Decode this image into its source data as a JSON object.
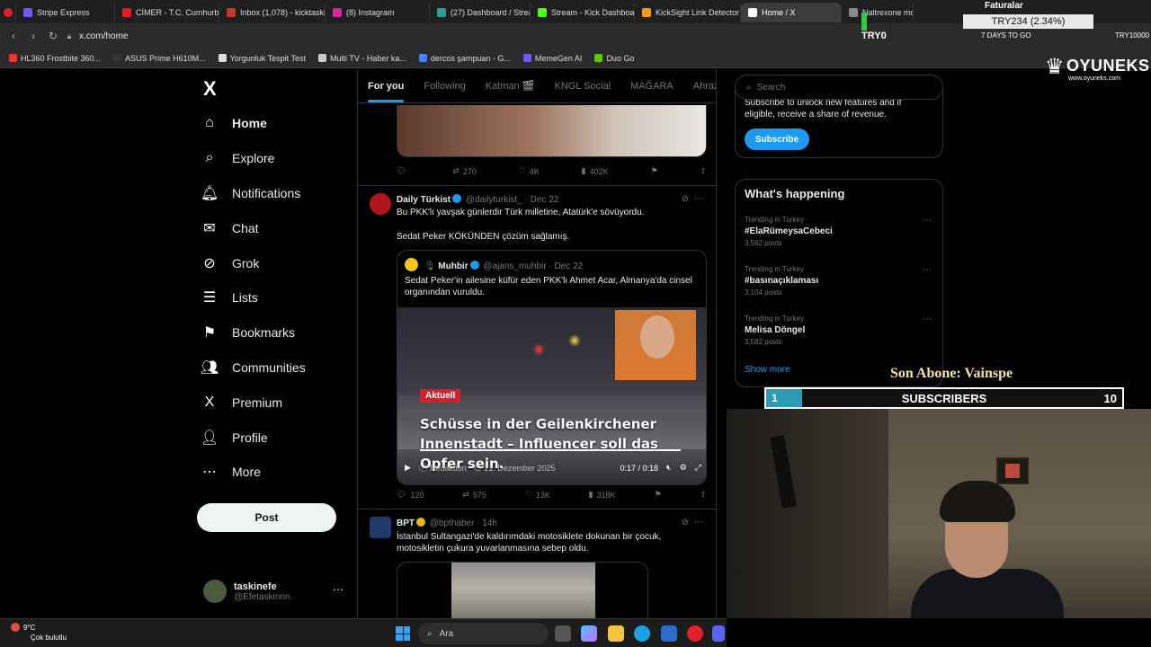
{
  "browser": {
    "tabs": [
      {
        "label": "Stripe Express",
        "color": "#6a5bff"
      },
      {
        "label": "CİMER - T.C. Cumhurbaşk",
        "color": "#e02020"
      },
      {
        "label": "Inbox (1,078) - kicktaskine",
        "color": "#c0392b"
      },
      {
        "label": "(8) Instagram",
        "color": "#d6249f"
      },
      {
        "label": "(27) Dashboard / Streamla",
        "color": "#2aa198"
      },
      {
        "label": "Stream - Kick Dashboard",
        "color": "#53fc18"
      },
      {
        "label": "KickSight Link Detector",
        "color": "#f39c12"
      },
      {
        "label": "Home / X",
        "color": "#ffffff"
      },
      {
        "label": "Naltrexone modulates de",
        "color": "#888888"
      }
    ],
    "url": "x.com/home",
    "bookmarks": [
      "HL360 Frostbite 360...",
      "ASUS Prime H610M...",
      "Yorgunluk Tespit Test",
      "Multi TV - Haber ka...",
      "dercos şampuan - G...",
      "MemeGen AI",
      "Duo Go"
    ]
  },
  "x": {
    "logo": "X",
    "nav": [
      {
        "label": "Home",
        "icon": "home-icon",
        "glyph": "⌂"
      },
      {
        "label": "Explore",
        "icon": "search-icon",
        "glyph": "⌕"
      },
      {
        "label": "Notifications",
        "icon": "bell-icon",
        "glyph": "🔔︎"
      },
      {
        "label": "Chat",
        "icon": "mail-icon",
        "glyph": "✉"
      },
      {
        "label": "Grok",
        "icon": "grok-icon",
        "glyph": "⊘"
      },
      {
        "label": "Lists",
        "icon": "list-icon",
        "glyph": "☰"
      },
      {
        "label": "Bookmarks",
        "icon": "bookmark-icon",
        "glyph": "⚑"
      },
      {
        "label": "Communities",
        "icon": "people-icon",
        "glyph": "👥︎"
      },
      {
        "label": "Premium",
        "icon": "x-premium-icon",
        "glyph": "X"
      },
      {
        "label": "Profile",
        "icon": "person-icon",
        "glyph": "👤︎"
      },
      {
        "label": "More",
        "icon": "more-circle-icon",
        "glyph": "⋯"
      }
    ],
    "post_label": "Post",
    "account": {
      "name": "taskinefe",
      "handle": "@Efetaskinnn"
    },
    "feed_tabs": [
      "For you",
      "Following",
      "Katman 🎬",
      "KNGL Social",
      "MAĞARA",
      "Ahrazlar"
    ],
    "prev_tweet_actions": {
      "replies": "",
      "reposts": "270",
      "likes": "4K",
      "views": "402K"
    },
    "tweet": {
      "name": "Daily Türkist",
      "handle": "@dailyturkist_",
      "date": "· Dec 22",
      "text1": "Bu PKK'lı yavşak günlerdir Türk milletine, Atatürk'e sövüyordu.",
      "text2": "Sedat Peker KÖKÜNDEN çözüm sağlamış.",
      "quote": {
        "name": "Muhbir",
        "handle": "@ajans_muhbir",
        "date": "· Dec 22",
        "text": "Sedat Peker'in ailesine küfür eden PKK'lı Ahmet Acar, Almanya'da cinsel organından vuruldu.",
        "video": {
          "badge": "Aktuell",
          "title": "Schüsse in der Geilenkirchener Innenstadt – Influencer soll das Opfer sein.",
          "source": "Redaktion",
          "date": "21. Dezember 2025",
          "time": "0:17 / 0:18"
        }
      },
      "actions": {
        "replies": "120",
        "reposts": "575",
        "likes": "13K",
        "views": "318K"
      }
    },
    "tweet2": {
      "name": "BPT",
      "handle": "@bpthaber",
      "date": "· 14h",
      "text": "İstanbul Sultangazi'de kaldırımdaki motosiklete dokunan bir çocuk, motosikletin çukura yuvarlanmasına sebep oldu."
    },
    "search_placeholder": "Search",
    "premium": {
      "text": "Subscribe to unlock new features and if eligible, receive a share of revenue.",
      "button": "Subscribe"
    },
    "happening": {
      "title": "What's happening",
      "trends": [
        {
          "context": "Trending in Turkey",
          "name": "#ElaRümeysaCebeci",
          "posts": "3,562 posts"
        },
        {
          "context": "Trending in Turkey",
          "name": "#basınaçıklaması",
          "posts": "3,104 posts"
        },
        {
          "context": "Trending in Turkey",
          "name": "Melisa Döngel",
          "posts": "3,582 posts"
        }
      ],
      "show_more": "Show more"
    }
  },
  "overlay": {
    "stock_title": "Faturalar",
    "stock_change": "TRY234 (2.34%)",
    "stock_code": "TRY0",
    "days_to_go": "7 DAYS TO GO",
    "stock_value": "TRY10000",
    "oyuneks": "OYUNEKS",
    "oyuneks_url": "www.oyuneks.com",
    "son_abone": "Son Abone: Vainspe",
    "subs": {
      "current": "1",
      "label": "SUBSCRIBERS",
      "goal": "10",
      "progress": 0.1
    }
  },
  "taskbar": {
    "weather_temp": "9°C",
    "weather_desc": "Çok bulutlu",
    "search": "Ara"
  }
}
